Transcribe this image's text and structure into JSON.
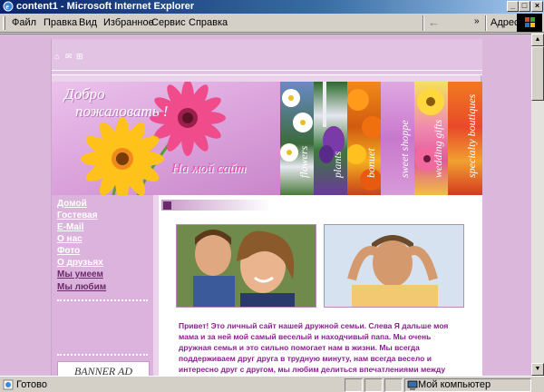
{
  "window": {
    "title": "content1 - Microsoft Internet Explorer",
    "controls": [
      "_",
      "□",
      "×"
    ]
  },
  "menu": {
    "items": [
      "Файл",
      "Правка",
      "Вид",
      "Избранное",
      "Сервис",
      "Справка"
    ],
    "back_label": "←",
    "overflow": "»",
    "address_label": "Адрес"
  },
  "site": {
    "top_icons": [
      "⌂",
      "✉",
      "⊞"
    ],
    "banner": {
      "welcome_line1": "Добро",
      "welcome_line2": "пожаловать !",
      "name": "На мой сайт",
      "strips": [
        "flowers",
        "plants",
        "bonuet",
        "sweet shoppe",
        "wedding gifts",
        "specialty boutiques"
      ]
    },
    "nav": {
      "links": [
        "Домой",
        "Гостевая",
        "E-Mail",
        "О нас",
        "Фото",
        "О друзьях"
      ],
      "dark_links": [
        "Мы умеем",
        "Мы любим"
      ],
      "banner_ad": "BANNER AD"
    },
    "intro_text": "Привет! Это личный сайт нашей дружной семьи. Слева Я дальше моя мама и за ней мой самый веселый и находчивый папа. Мы очень дружная семья и это сильно помогает нам в жизни. Мы всегда поддерживаем друг друга в трудную минуту, нам всегда весело и интересно друг с другом, мы любим делиться впечатлениями между собой, любим розыгрыши, частенько подтруниваем над самими собой,"
  },
  "status": {
    "text": "Готово",
    "zone": "Мой компьютер"
  },
  "colors": {
    "page_bg": "#dbb7dc",
    "accent": "#8b2290",
    "title_bar": "#0a246a"
  }
}
